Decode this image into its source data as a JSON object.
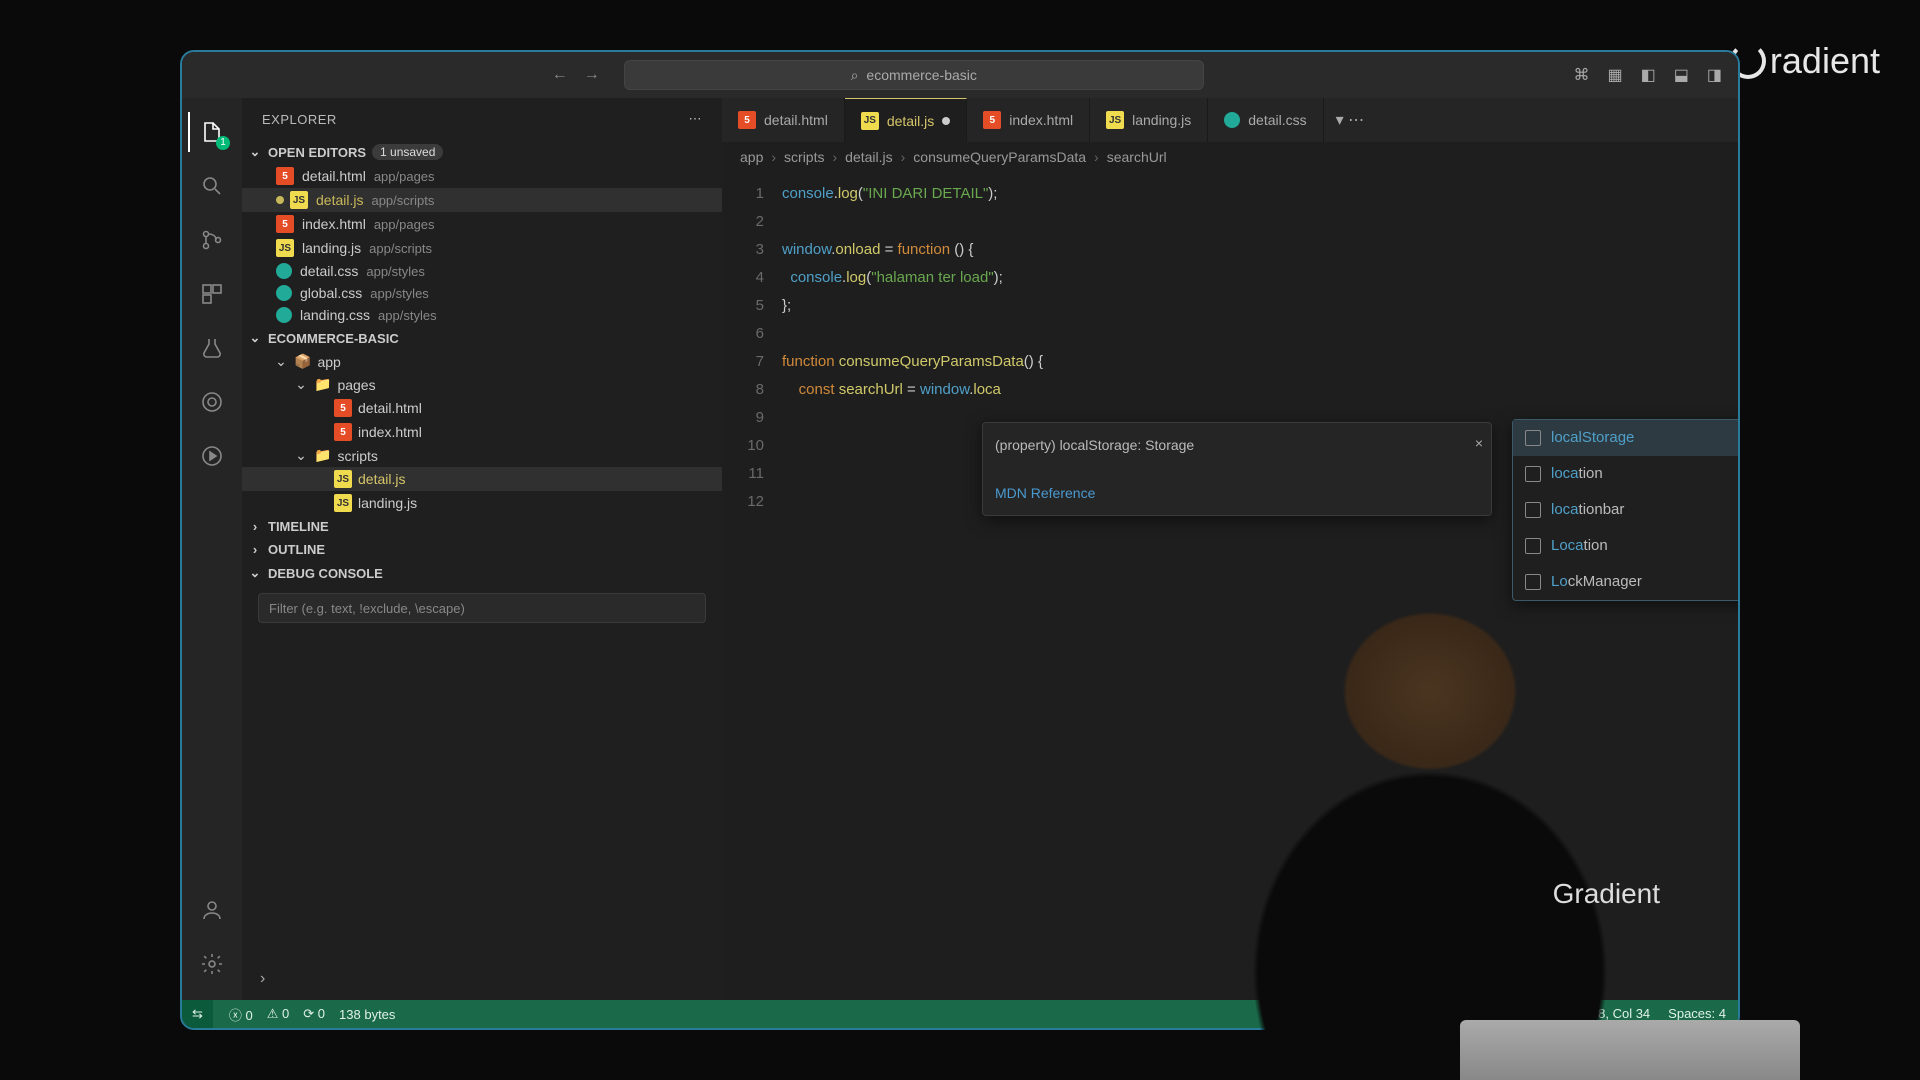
{
  "watermark": "radient",
  "titlebar": {
    "search": "ecommerce-basic"
  },
  "activity": {
    "explorer_badge": "1"
  },
  "sidebar": {
    "title": "EXPLORER",
    "open_editors": {
      "label": "OPEN EDITORS",
      "unsaved": "1 unsaved",
      "items": [
        {
          "name": "detail.html",
          "path": "app/pages",
          "type": "html"
        },
        {
          "name": "detail.js",
          "path": "app/scripts",
          "type": "js",
          "unsaved": true
        },
        {
          "name": "index.html",
          "path": "app/pages",
          "type": "html"
        },
        {
          "name": "landing.js",
          "path": "app/scripts",
          "type": "js"
        },
        {
          "name": "detail.css",
          "path": "app/styles",
          "type": "css"
        },
        {
          "name": "global.css",
          "path": "app/styles",
          "type": "css"
        },
        {
          "name": "landing.css",
          "path": "app/styles",
          "type": "css"
        }
      ]
    },
    "project": {
      "label": "ECOMMERCE-BASIC",
      "tree": [
        {
          "indent": 1,
          "chev": "⌄",
          "icon": "app",
          "name": "app"
        },
        {
          "indent": 2,
          "chev": "⌄",
          "icon": "folder",
          "name": "pages"
        },
        {
          "indent": 3,
          "icon": "html",
          "name": "detail.html"
        },
        {
          "indent": 3,
          "icon": "html",
          "name": "index.html"
        },
        {
          "indent": 2,
          "chev": "⌄",
          "icon": "folder",
          "name": "scripts"
        },
        {
          "indent": 3,
          "icon": "js",
          "name": "detail.js",
          "sel": true
        },
        {
          "indent": 3,
          "icon": "js",
          "name": "landing.js"
        }
      ]
    },
    "timeline": "TIMELINE",
    "outline": "OUTLINE",
    "debug": "DEBUG CONSOLE",
    "filter_placeholder": "Filter (e.g. text, !exclude, \\escape)"
  },
  "tabs": [
    {
      "icon": "html",
      "name": "detail.html"
    },
    {
      "icon": "js",
      "name": "detail.js",
      "active": true,
      "unsaved": true
    },
    {
      "icon": "html",
      "name": "index.html"
    },
    {
      "icon": "js",
      "name": "landing.js"
    },
    {
      "icon": "css",
      "name": "detail.css"
    }
  ],
  "breadcrumbs": [
    "app",
    "scripts",
    "detail.js",
    "consumeQueryParamsData",
    "searchUrl"
  ],
  "code_lines": [
    "console.log(\"INI DARI DETAIL\");",
    "",
    "window.onload = function () {",
    "  console.log(\"halaman ter load\");",
    "};",
    "",
    "function consumeQueryParamsData() {",
    "    const searchUrl = window.loca",
    "",
    "",
    "",
    ""
  ],
  "tooltip": {
    "signature": "(property) localStorage: Storage",
    "mdn": "MDN Reference"
  },
  "suggestions": [
    {
      "text": "localStorage",
      "match": "loca",
      "rest": "lStorage",
      "sel": true
    },
    {
      "text": "location",
      "match": "loca",
      "rest": "tion"
    },
    {
      "text": "locationbar",
      "match": "loca",
      "rest": "tionbar"
    },
    {
      "text": "Location",
      "match": "Loca",
      "rest": "tion"
    },
    {
      "text": "LockManager",
      "match": "Lo",
      "rest": "ckManager"
    }
  ],
  "statusbar": {
    "errors": "0",
    "warnings": "0",
    "ports": "0",
    "size": "138 bytes",
    "position": "Ln 8, Col 34",
    "spaces": "Spaces: 4"
  },
  "gradient_shirt": "Gradient"
}
